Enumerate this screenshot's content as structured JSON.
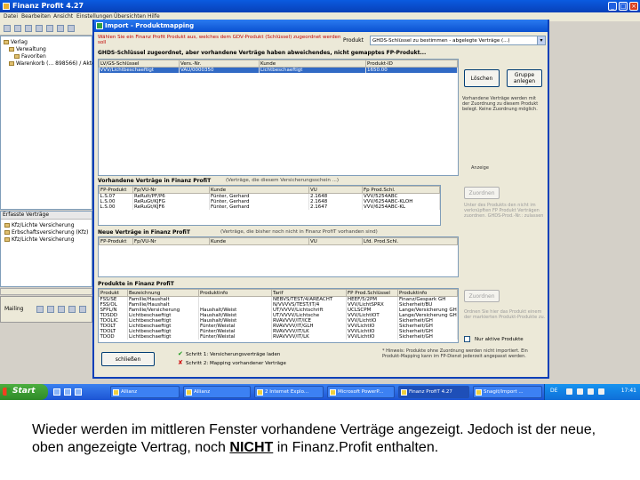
{
  "window": {
    "title": "Finanz Profit 4.27",
    "min": "_",
    "max": "□",
    "close": "×"
  },
  "menu": [
    "Datei",
    "Bearbeiten",
    "Ansicht",
    "Einstellungen",
    "Übersichten",
    "Hilfe"
  ],
  "tree": [
    {
      "label": "Verlag",
      "indent": 0
    },
    {
      "label": "Verwaltung",
      "indent": 1
    },
    {
      "label": "Favoriten",
      "indent": 2
    },
    {
      "label": "Warenkorb (... 898566) / Akte",
      "indent": 1
    }
  ],
  "contracts_pane": {
    "header": "Erfasste Verträge",
    "items": [
      "Kfz/Lichte Versicherung",
      "Erbschaftsversicherung (Kfz)",
      "Kfz/Lichte Versicherung"
    ]
  },
  "nav": {
    "label": "Mailing"
  },
  "dialog": {
    "title": "Import - Produktmapping",
    "hint": "Wählen Sie ein Finanz Profit Produkt aus, welches dem GDV-Produkt (Schlüssel) zugeordnet werden soll",
    "product_label": "Produkt",
    "product_select": "GHDS-Schlüssel zu bestimmen - abgelegte Verträge (...)",
    "section1_title": "GHDS-Schlüssel zugeordnet, aber vorhandene Verträge haben abweichendes, nicht gemapptes FP-Produkt...",
    "grid1": {
      "columns": [
        "LV/GS-Schlüssel",
        "Vers.-Nr.",
        "Kunde",
        "Produkt-ID"
      ],
      "rows": [
        {
          "cells": [
            "VVV/Lichtbeschaeftigt",
            "VAU/0000350",
            "Lichtbeschaeftigt",
            "1650.00"
          ],
          "selected": true
        }
      ]
    },
    "btn_delete": "Löschen",
    "btn_group": "Gruppe anlegen",
    "side_note1": "Vorhandene Verträge werden mit der Zuordnung zu diesem Produkt belegt. Keine Zuordnung möglich.",
    "side_note2": "Anzeige",
    "section2_title": "Vorhandene Verträge in Finanz ProfiT",
    "section2_note": "(Verträge, die diesem Versicherungsschein ...)",
    "grid2": {
      "columns": [
        "FP-Produkt",
        "Fp/VU-Nr",
        "Kunde",
        "VU",
        "Fp Prod.Schl."
      ],
      "rows": [
        {
          "cells": [
            "L.S.07",
            "ReRuIt/PF/P6",
            "Fünter, Gerhard",
            "2.1648",
            "VVV/5254ABC"
          ]
        },
        {
          "cells": [
            "L.S.00",
            "ReRuGt/KJFG",
            "Fünter, Gerhard",
            "2.1648",
            "VVV/6254ABC-KLOH"
          ]
        },
        {
          "cells": [
            "L.S.00",
            "ReRuGt/KJF6",
            "Fünter, Gerhard",
            "2.1647",
            "VVV/6254ABC-KL"
          ]
        }
      ]
    },
    "btn_assign1": "Zuordnen",
    "side_note3": "Unter des Produkts den nicht im verknüpften FP Produkt Verträgen zuordnen. GHDS-Prod.-Nr.: zulassen",
    "section3_title": "Neue Verträge in Finanz ProfiT",
    "section3_note": "(Verträge, die bisher noch nicht in Finanz ProfiT vorhanden sind)",
    "grid3": {
      "columns": [
        "FP-Produkt",
        "Fp/VU-Nr",
        "Kunde",
        "VU",
        "Lfd. Prod.Schl."
      ],
      "rows": []
    },
    "section4_title": "Produkte in Finanz ProfiT",
    "grid4": {
      "columns": [
        "Produkt",
        "Bezeichnung",
        "Produktinfo",
        "Tarif",
        "FP Prod.Schlüssel",
        "Produktinfo"
      ],
      "rows": [
        {
          "cells": [
            "FSS/SE",
            "Familie/Haushalt",
            "",
            "NEBVS/TEST/4/AREACHT",
            "HEEF/5/2PM",
            "Finanz/Gespark GH"
          ]
        },
        {
          "cells": [
            "FSS/OL",
            "Familie/Haushalt",
            "",
            "N/VVVVS/TEST/IT/4",
            "VVV/LichtSPRX",
            "Sicherheit/BU"
          ]
        },
        {
          "cells": [
            "SFPL/N",
            "Familie/Versicherung",
            "Haushalt/Weist",
            "UT/VVVV/Lichtschrift",
            "UCLSCPM",
            "Lange/Versicherung GH"
          ]
        },
        {
          "cells": [
            "TDSDD",
            "Lichtbeschaeftigt",
            "Haushalt/Weist",
            "UT/VVVV/Lichtsche",
            "VVV/LichtIOT",
            "Lange/Versicherung GH"
          ]
        },
        {
          "cells": [
            "TDOLIC",
            "Lichtbeschaeftigt",
            "Haushalt/Weist",
            "RVAVVVV/IT/ICE",
            "VVV/LichtIO",
            "Sicherheit/GH"
          ]
        },
        {
          "cells": [
            "TDOLT",
            "Lichtbeschaeftigt",
            "Fünter/Weistal",
            "RVAVVVV/IT/GLH",
            "VVVLichtIO",
            "Sicherheit/GH"
          ]
        },
        {
          "cells": [
            "TDOLT",
            "Lichtbeschaeftigt",
            "Fünter/Weistal",
            "RVAVVVV/IT/LK",
            "VVVLichtIO",
            "Sicherheit/GH"
          ]
        },
        {
          "cells": [
            "TDOD",
            "Lichtbeschaeftigt",
            "Fünter/Weistal",
            "RVAVVVV/IT/LK",
            "VVVLichtIO",
            "Sicherheit/GH"
          ]
        }
      ]
    },
    "btn_assign2": "Zuordnen",
    "side_note4": "Ordnen Sie hier das Produkt einem der markierten Produkt-Produkte zu.",
    "checkbox_label": "Nur aktive Produkte",
    "btn_close": "schließen",
    "step1": "Schritt 1: Versicherungsverträge laden",
    "step2": "Schritt 2: Mapping vorhandener Verträge",
    "bottom_note": "* Hinweis: Produkte ohne Zuordnung werden nicht importiert. Ein Produkt-Mapping kann im FP-Dienst jederzeit angepasst werden."
  },
  "taskbar": {
    "start": "Start",
    "tasks": [
      {
        "label": "Allianz",
        "active": false
      },
      {
        "label": "Allianz",
        "active": false
      },
      {
        "label": "2 Internet Explo...",
        "active": false
      },
      {
        "label": "Microsoft PowerP...",
        "active": false
      },
      {
        "label": "Finanz ProfiT 4.27",
        "active": true
      },
      {
        "label": "Snagit/Import ...",
        "active": false
      }
    ],
    "lang": "DE",
    "clock": "17:41"
  },
  "caption": {
    "part1": "Wieder werden im mittleren Fenster vorhandene Verträge angezeigt. Jedoch ist der neue, oben angezeigte Vertrag, noch ",
    "emph": "NICHT",
    "part2": " in Finanz.Profit enthalten."
  },
  "colors": {
    "accent": "#0840b8",
    "selection": "#316ac5",
    "hint": "#c00000"
  }
}
